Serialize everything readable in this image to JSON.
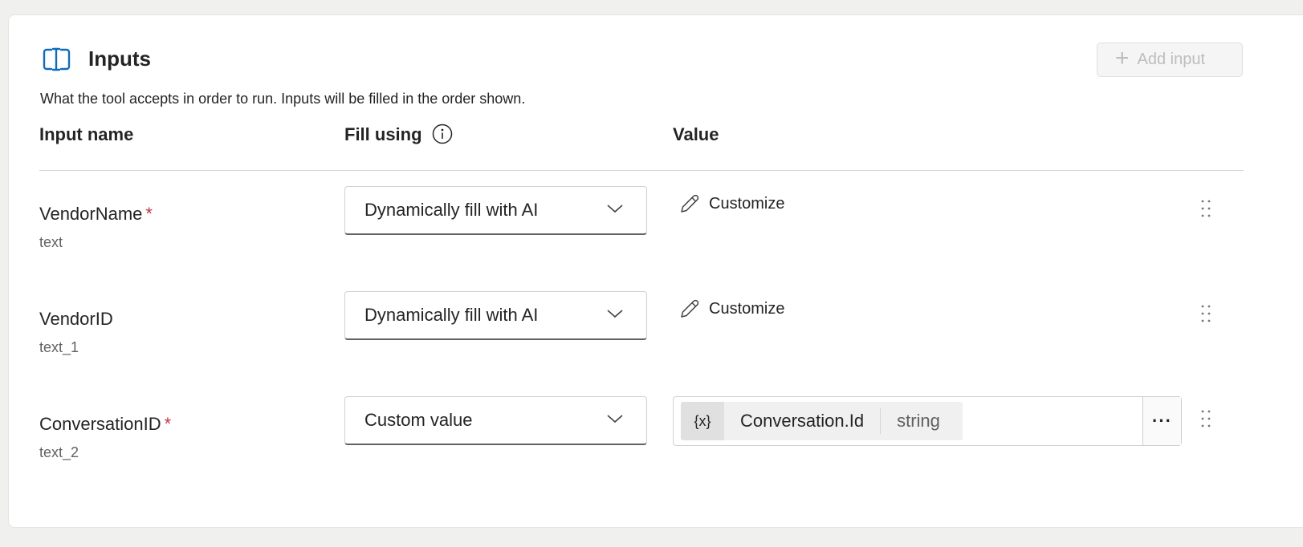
{
  "section": {
    "title": "Inputs",
    "description": "What the tool accepts in order to run. Inputs will be filled in the order shown.",
    "add_button_label": "Add input",
    "icon": "input-bracket-icon"
  },
  "columns": {
    "input_name": "Input name",
    "fill_using": "Fill using",
    "value": "Value"
  },
  "rows": [
    {
      "name": "VendorName",
      "required": "*",
      "type": "text",
      "fill_using": "Dynamically fill with AI",
      "value_action": "Customize"
    },
    {
      "name": "VendorID",
      "required": "",
      "type": "text_1",
      "fill_using": "Dynamically fill with AI",
      "value_action": "Customize"
    },
    {
      "name": "ConversationID",
      "required": "*",
      "type": "text_2",
      "fill_using": "Custom value",
      "value_token": {
        "prefix": "{x}",
        "name": "Conversation.Id",
        "type": "string"
      },
      "more_label": "···"
    }
  ],
  "colors": {
    "accent": "#0f6cbd",
    "required": "#c4314b",
    "disabled_text": "#bdbdbd"
  }
}
